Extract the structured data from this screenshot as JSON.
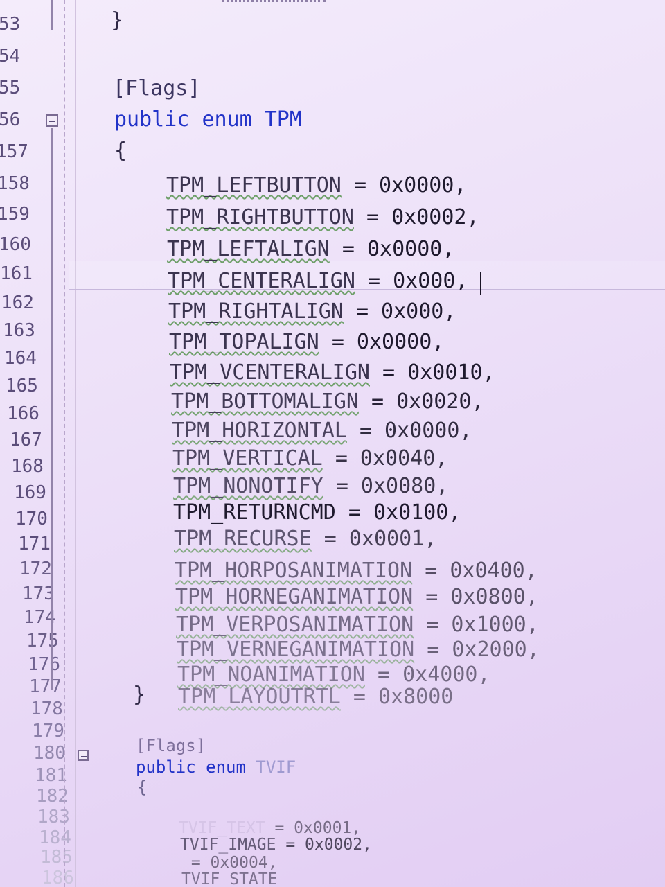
{
  "gutter": {
    "lines": [
      "53",
      "54",
      "55",
      "56",
      "157",
      "158",
      "159",
      "160",
      "161",
      "162",
      "163",
      "164",
      "165",
      "166",
      "167",
      "168",
      "169",
      "170",
      "171",
      "172",
      "173",
      "174",
      "175",
      "176",
      "177",
      "178",
      "179",
      "180",
      "181",
      "182",
      "183",
      "184",
      "185",
      "186"
    ]
  },
  "code": {
    "close_brace": "}",
    "attr1": "[Flags]",
    "kw_public": "public",
    "kw_enum": "enum",
    "enum1_name": "TPM",
    "open_brace": "{",
    "members": [
      {
        "name": "TPM_LEFTBUTTON",
        "value": "= 0x0000,"
      },
      {
        "name": "TPM_RIGHTBUTTON",
        "value": "= 0x0002,"
      },
      {
        "name": "TPM_LEFTALIGN",
        "value": "= 0x0000,"
      },
      {
        "name": "TPM_CENTERALIGN",
        "value": "= 0x000,"
      },
      {
        "name": "TPM_RIGHTALIGN",
        "value": "= 0x000,"
      },
      {
        "name": "TPM_TOPALIGN",
        "value": "= 0x0000,"
      },
      {
        "name": "TPM_VCENTERALIGN",
        "value": "= 0x0010,"
      },
      {
        "name": "TPM_BOTTOMALIGN",
        "value": "= 0x0020,"
      },
      {
        "name": "TPM_HORIZONTAL",
        "value": "= 0x0000,"
      },
      {
        "name": "TPM_VERTICAL",
        "value": "= 0x0040,"
      },
      {
        "name": "TPM_NONOTIFY",
        "value": "= 0x0080,"
      },
      {
        "name": "TPM_RETURNCMD",
        "value": "= 0x0100,"
      },
      {
        "name": "TPM_RECURSE",
        "value": "= 0x0001,"
      },
      {
        "name": "TPM_HORPOSANIMATION",
        "value": "= 0x0400,"
      },
      {
        "name": "TPM_HORNEGANIMATION",
        "value": "= 0x0800,"
      },
      {
        "name": "TPM_VERPOSANIMATION",
        "value": "= 0x1000,"
      },
      {
        "name": "TPM_VERNEGANIMATION",
        "value": "= 0x2000,"
      },
      {
        "name": "TPM_NOANIMATION",
        "value": "= 0x4000,"
      },
      {
        "name": "TPM_LAYOUTRTL",
        "value": "= 0x8000"
      }
    ],
    "enum1_close": "}",
    "attr2": "[Flags]",
    "enum2_name": "TVIF",
    "enum2_open": "{",
    "members2": [
      {
        "name": "TVIF_TEXT",
        "value": "= 0x0001,"
      },
      {
        "name": "TVIF_IMAGE",
        "value": "= 0x0002,"
      },
      {
        "name": "",
        "value": "= 0x0004,"
      },
      {
        "name": "TVIF_STATE",
        "value": ""
      }
    ]
  },
  "colors": {
    "keyword": "#2233c8",
    "background": "#ecdff8",
    "squiggle": "#6fa06a"
  }
}
